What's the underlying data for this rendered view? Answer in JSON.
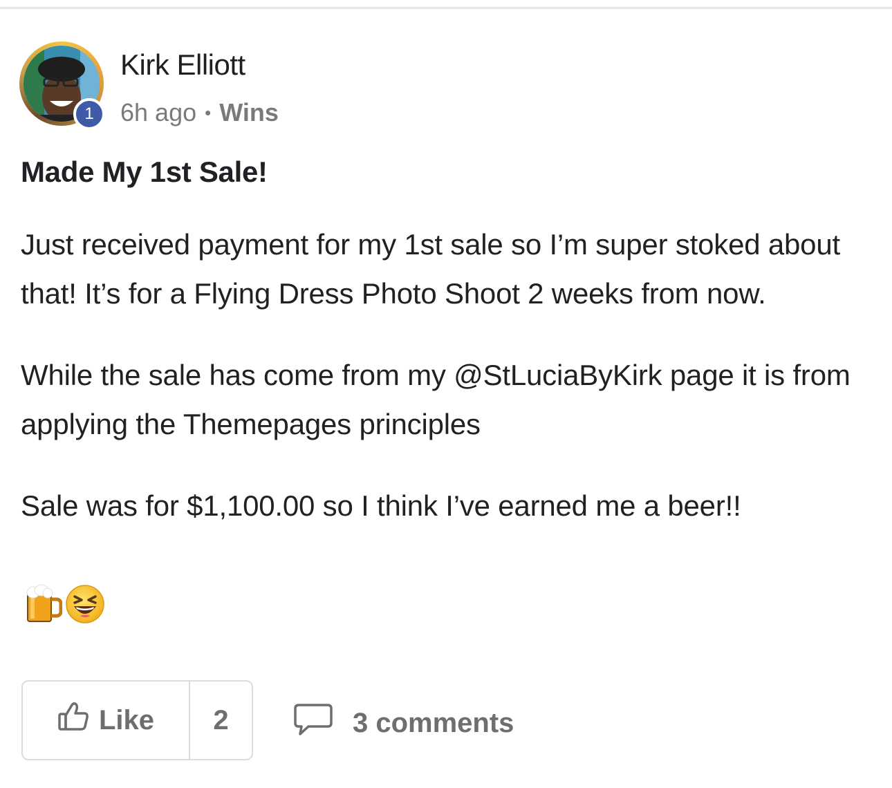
{
  "post": {
    "author": "Kirk Elliott",
    "level": "1",
    "time": "6h ago",
    "separator": "•",
    "category": "Wins",
    "title": "Made My 1st Sale!",
    "paragraphs": [
      "Just received payment for my 1st sale so I’m super stoked about that! It’s for a Flying Dress Photo Shoot 2 weeks from now.",
      "While the sale has come from my @StLuciaByKirk page it is from applying the Themepages principles",
      "Sale was for $1,100.00 so I think I’ve earned me a beer!!"
    ],
    "emojis": [
      "beer-mug-icon",
      "laughing-face-icon"
    ]
  },
  "actions": {
    "like_label": "Like",
    "like_count": "2",
    "comments_label": "3 comments"
  },
  "colors": {
    "badge": "#3f5aa6",
    "text": "#202124",
    "muted": "#7a7a7a",
    "border": "#dcdcdc"
  }
}
